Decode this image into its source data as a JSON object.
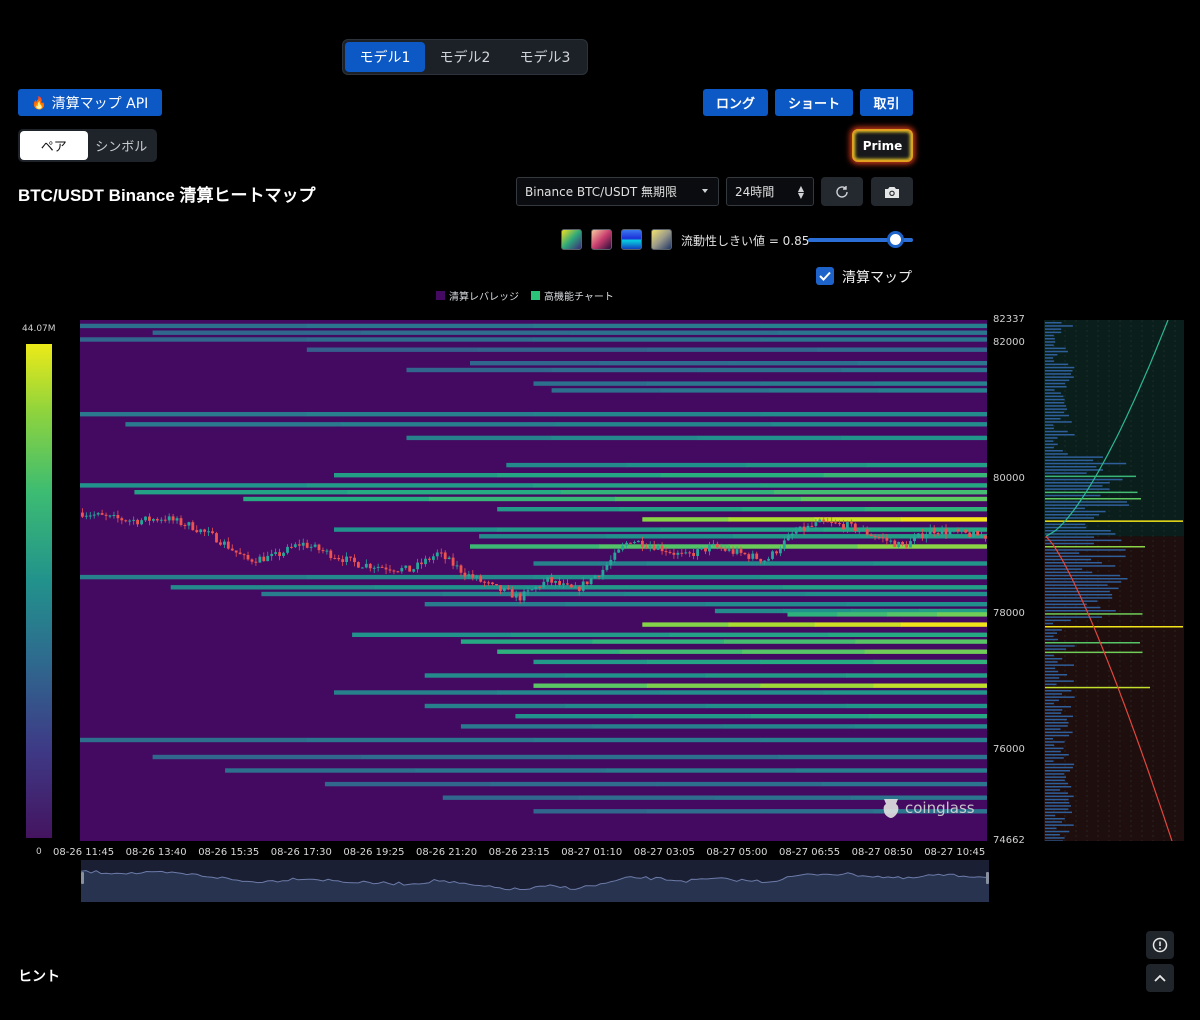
{
  "model_tabs": [
    "モデル1",
    "モデル2",
    "モデル3"
  ],
  "active_model": "モデル1",
  "api_button": "清算マップ API",
  "trade_buttons": {
    "long": "ロング",
    "short": "ショート",
    "trade": "取引"
  },
  "pair_toggle": {
    "pair": "ペア",
    "symbol": "シンボル",
    "active": "ペア"
  },
  "prime": "Prime",
  "title": "BTC/USDT Binance 清算ヒートマップ",
  "exchange_select": "Binance BTC/USDT 無期限",
  "period_select": "24時間",
  "threshold_label": "流動性しきい値 = 0.85",
  "threshold_value": 0.85,
  "liquidation_map_label": "清算マップ",
  "liquidation_map_checked": true,
  "legend": [
    {
      "label": "清算レバレッジ",
      "color": "#440a61"
    },
    {
      "label": "高機能チャート",
      "color": "#2bc37a"
    }
  ],
  "colorbar": {
    "max": "44.07M",
    "min": "0"
  },
  "hint": "ヒント",
  "watermark": "coinglass",
  "colors": {
    "accent": "#0c58c4",
    "heat_low": "#440a61",
    "heat_high": "#f2e41a",
    "up": "#26a69a",
    "down": "#ef5350"
  },
  "chart_data": {
    "type": "heatmap",
    "title": "BTC/USDT Binance 清算ヒートマップ",
    "x_ticks": [
      "08-26 11:45",
      "08-26 13:40",
      "08-26 15:35",
      "08-26 17:30",
      "08-26 19:25",
      "08-26 21:20",
      "08-26 23:15",
      "08-27 01:10",
      "08-27 03:05",
      "08-27 05:00",
      "08-27 06:55",
      "08-27 08:50",
      "08-27 10:45"
    ],
    "y_ticks": [
      "82337",
      "82000",
      "80000",
      "78000",
      "76000",
      "74662"
    ],
    "ylim": [
      74662,
      82337
    ],
    "color_range": [
      0,
      44070000
    ],
    "bands": [
      {
        "price": 82250,
        "start": 0.0,
        "intensity": 0.35
      },
      {
        "price": 82150,
        "start": 0.08,
        "intensity": 0.3
      },
      {
        "price": 82050,
        "start": 0.0,
        "intensity": 0.3
      },
      {
        "price": 81900,
        "start": 0.25,
        "intensity": 0.25
      },
      {
        "price": 81700,
        "start": 0.43,
        "intensity": 0.3
      },
      {
        "price": 81600,
        "start": 0.36,
        "intensity": 0.3
      },
      {
        "price": 81400,
        "start": 0.5,
        "intensity": 0.35
      },
      {
        "price": 81300,
        "start": 0.52,
        "intensity": 0.35
      },
      {
        "price": 80950,
        "start": 0.0,
        "intensity": 0.4
      },
      {
        "price": 80800,
        "start": 0.05,
        "intensity": 0.4
      },
      {
        "price": 80600,
        "start": 0.36,
        "intensity": 0.45
      },
      {
        "price": 80200,
        "start": 0.47,
        "intensity": 0.5
      },
      {
        "price": 80050,
        "start": 0.28,
        "intensity": 0.62
      },
      {
        "price": 79900,
        "start": 0.0,
        "intensity": 0.55
      },
      {
        "price": 79800,
        "start": 0.06,
        "intensity": 0.65
      },
      {
        "price": 79700,
        "start": 0.18,
        "intensity": 0.72
      },
      {
        "price": 79550,
        "start": 0.46,
        "intensity": 0.6
      },
      {
        "price": 79400,
        "start": 0.62,
        "intensity": 1.0
      },
      {
        "price": 79250,
        "start": 0.28,
        "intensity": 0.55
      },
      {
        "price": 79150,
        "start": 0.44,
        "intensity": 0.5
      },
      {
        "price": 79000,
        "start": 0.43,
        "intensity": 0.8
      },
      {
        "price": 78750,
        "start": 0.5,
        "intensity": 0.45
      },
      {
        "price": 78550,
        "start": 0.0,
        "intensity": 0.45
      },
      {
        "price": 78400,
        "start": 0.1,
        "intensity": 0.5
      },
      {
        "price": 78300,
        "start": 0.2,
        "intensity": 0.42
      },
      {
        "price": 78150,
        "start": 0.38,
        "intensity": 0.42
      },
      {
        "price": 78050,
        "start": 0.7,
        "intensity": 0.5
      },
      {
        "price": 78000,
        "start": 0.78,
        "intensity": 0.75
      },
      {
        "price": 77850,
        "start": 0.62,
        "intensity": 1.0
      },
      {
        "price": 77700,
        "start": 0.3,
        "intensity": 0.55
      },
      {
        "price": 77600,
        "start": 0.42,
        "intensity": 0.7
      },
      {
        "price": 77450,
        "start": 0.46,
        "intensity": 0.75
      },
      {
        "price": 77300,
        "start": 0.5,
        "intensity": 0.6
      },
      {
        "price": 77100,
        "start": 0.38,
        "intensity": 0.5
      },
      {
        "price": 76950,
        "start": 0.5,
        "intensity": 0.9
      },
      {
        "price": 76850,
        "start": 0.28,
        "intensity": 0.45
      },
      {
        "price": 76650,
        "start": 0.38,
        "intensity": 0.45
      },
      {
        "price": 76500,
        "start": 0.48,
        "intensity": 0.55
      },
      {
        "price": 76350,
        "start": 0.42,
        "intensity": 0.4
      },
      {
        "price": 76150,
        "start": 0.0,
        "intensity": 0.35
      },
      {
        "price": 75900,
        "start": 0.08,
        "intensity": 0.3
      },
      {
        "price": 75700,
        "start": 0.16,
        "intensity": 0.35
      },
      {
        "price": 75500,
        "start": 0.27,
        "intensity": 0.3
      },
      {
        "price": 75300,
        "start": 0.4,
        "intensity": 0.3
      },
      {
        "price": 75100,
        "start": 0.5,
        "intensity": 0.3
      }
    ],
    "price_path": [
      79500,
      79420,
      79380,
      79420,
      79300,
      79100,
      78800,
      78850,
      79050,
      78900,
      78750,
      78700,
      78650,
      78900,
      78600,
      78400,
      78250,
      78500,
      78350,
      78650,
      79100,
      79000,
      78850,
      79000,
      78900,
      78800,
      79200,
      79350,
      79300,
      79150,
      79000,
      79250,
      79200,
      79150
    ]
  }
}
